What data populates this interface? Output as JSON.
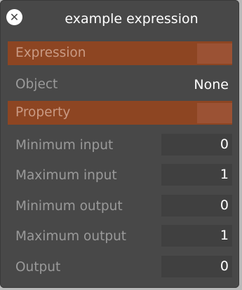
{
  "window": {
    "title": "example expression"
  },
  "rows": [
    {
      "label": "Expression"
    },
    {
      "label": "Object",
      "value": "None"
    },
    {
      "label": "Property"
    },
    {
      "label": "Minimum input",
      "value": "0"
    },
    {
      "label": "Maximum input",
      "value": "1"
    },
    {
      "label": "Minimum output",
      "value": "0"
    },
    {
      "label": "Maximum output",
      "value": "1"
    },
    {
      "label": "Output",
      "value": "0"
    }
  ],
  "colors": {
    "panel_bg": "#484848",
    "highlight_row": "#8d4522",
    "swatch": "#9b5234",
    "field_bg": "#404040"
  }
}
